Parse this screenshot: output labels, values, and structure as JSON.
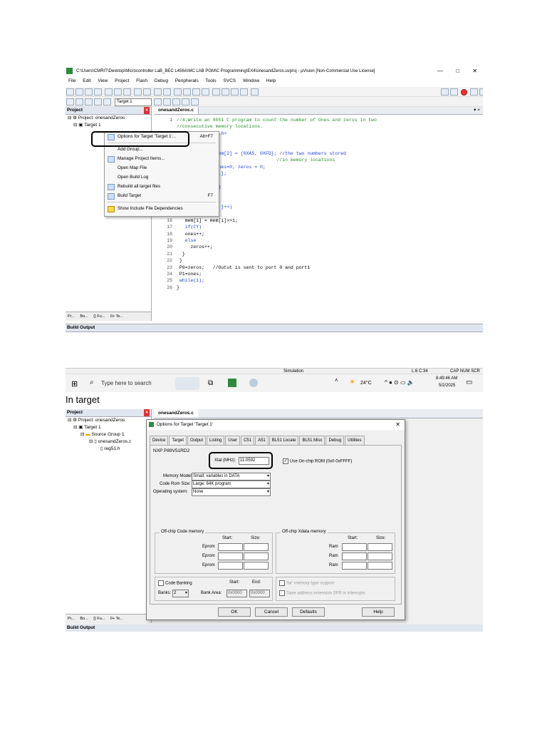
{
  "window": {
    "title": "C:\\Users\\CMRIT\\Desktop\\Microcontroller LaB_BEC L456A\\MC LAB PGM\\C Programming\\EX4\\onesandZeros.uvproj - µVision  [Non-Commercial Use License]",
    "min": "—",
    "max": "□",
    "close": "✕"
  },
  "menu": [
    "File",
    "Edit",
    "View",
    "Project",
    "Flash",
    "Debug",
    "Peripherals",
    "Tools",
    "SVCS",
    "Window",
    "Help"
  ],
  "toolbar2": {
    "target": "Target 1"
  },
  "project_panel": {
    "header": "Project",
    "root": "Project: onesandZeros",
    "target": "Target 1",
    "group": "Source Group 1",
    "file": "onesandZeros.c",
    "header_file": "reg51.h",
    "bottom_tabs": [
      "Pr...",
      "Bo...",
      "{} Fu...",
      "0+ Te..."
    ]
  },
  "editor": {
    "tab": "onesandZeros.c",
    "lines": [
      {
        "n": "1",
        "t": "//4.Write an 8051 C program to count the number of Ones and zeros in two"
      },
      {
        "n": "",
        "t": "//consecutive memory locations."
      },
      {
        "n": "",
        "t": "#include <reg51.h>"
      },
      {
        "n": "",
        "t": ""
      },
      {
        "n": "",
        "t": ""
      },
      {
        "n": "",
        "t": "unsigned char mem[2] = {0XA5, 0XFD}; //the two numbers stored"
      },
      {
        "n": "",
        "t": "                                    //in memory locations"
      },
      {
        "n": "",
        "t": "unsigned char ones=0, zeros = 0;"
      },
      {
        "n": "",
        "t": "unsigned char i,j;"
      },
      {
        "n": "",
        "t": ""
      },
      {
        "n": "",
        "t": "for(i=0;i<2;i++)"
      },
      {
        "n": "",
        "t": ""
      },
      {
        "n": "",
        "t": ""
      },
      {
        "n": "",
        "t": "  for(j=0; j<8; j++)"
      },
      {
        "n": "15",
        "t": "  {"
      },
      {
        "n": "16",
        "t": "   mem[i] = mem[i]>>1;"
      },
      {
        "n": "17",
        "t": "   if(CY)"
      },
      {
        "n": "18",
        "t": "   ones++;"
      },
      {
        "n": "19",
        "t": "   else"
      },
      {
        "n": "20",
        "t": "     zeros++;"
      },
      {
        "n": "21",
        "t": "  }"
      },
      {
        "n": "22",
        "t": " }"
      },
      {
        "n": "23",
        "t": " P0=zeros;   //Outut is sent to port 0 and port1"
      },
      {
        "n": "24",
        "t": " P1=ones;"
      },
      {
        "n": "25",
        "t": " while(1);"
      },
      {
        "n": "26",
        "t": "}"
      }
    ]
  },
  "context_menu": [
    {
      "label": "Options for Target 'Target 1'...",
      "shortcut": "Alt+F7"
    },
    {
      "label": "Add Group...",
      "shortcut": ""
    },
    {
      "label": "Manage Project Items...",
      "shortcut": ""
    },
    {
      "label": "Open Map File",
      "shortcut": ""
    },
    {
      "label": "Open Build Log",
      "shortcut": ""
    },
    {
      "label": "Rebuild all target files",
      "shortcut": ""
    },
    {
      "label": "Build Target",
      "shortcut": "F7"
    },
    {
      "label": "Show Include File Dependencies",
      "shortcut": ""
    }
  ],
  "build_output": {
    "header": "Build Output"
  },
  "statusbar": {
    "mode": "Simulation",
    "pos": "L:6 C:34",
    "caps": "CAP  NUM  SCR"
  },
  "taskbar": {
    "search": "Type here to search",
    "temp": "24°C",
    "time": "8:49:46 AM",
    "date": "5/2/2025"
  },
  "caption": "In target",
  "dialog": {
    "title": "Options for Target 'Target 1'",
    "tabs": [
      "Device",
      "Target",
      "Output",
      "Listing",
      "User",
      "C51",
      "A51",
      "BL51 Locate",
      "BL51 Misc",
      "Debug",
      "Utilities"
    ],
    "active_tab": "Target",
    "device": "NXP P89V51RD2",
    "xtal_label": "Xtal (MHz):",
    "xtal_value": "11.0592",
    "onchip_rom": "Use On-chip ROM (0x0-0xFFFF)",
    "memory_model_label": "Memory Model:",
    "memory_model": "Small: variables in DATA",
    "code_rom_label": "Code Rom Size:",
    "code_rom": "Large: 64K program",
    "os_label": "Operating system:",
    "os": "None",
    "offchip_code": "Off-chip Code memory",
    "offchip_xdata": "Off-chip Xdata memory",
    "start": "Start:",
    "size": "Size:",
    "eprom": "Eprom",
    "ram": "Ram",
    "code_banking": "Code Banking",
    "banks_label": "Banks:",
    "banks": "2",
    "bank_area": "Bank Area:",
    "bank_start": "0x0000",
    "bank_end": "0x0000",
    "start2": "Start:",
    "end2": "End:",
    "far_memory": "'far' memory type support",
    "save_addr": "Save address extension SFR in interrupts",
    "ok": "OK",
    "cancel": "Cancel",
    "defaults": "Defaults",
    "help": "Help"
  },
  "colors": {
    "highlight": "#000000",
    "accent": "#1f3fd6",
    "comment": "#2a8c2a"
  }
}
